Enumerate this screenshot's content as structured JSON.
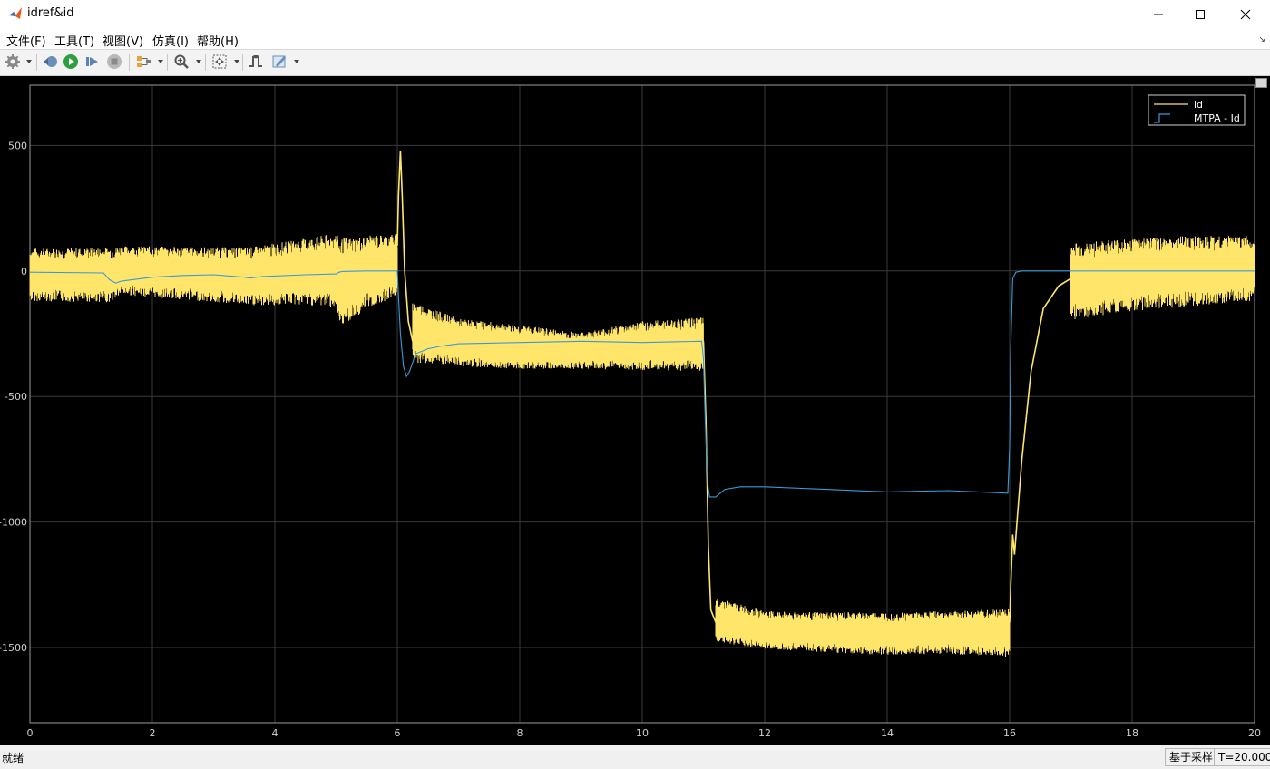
{
  "window": {
    "title": "idref&id"
  },
  "menu": {
    "items": [
      {
        "label": "文件(F)"
      },
      {
        "label": "工具(T)"
      },
      {
        "label": "视图(V)"
      },
      {
        "label": "仿真(I)"
      },
      {
        "label": "帮助(H)"
      }
    ]
  },
  "toolbar": {
    "icons": [
      "gear-icon",
      "step-back-icon",
      "run-icon",
      "step-forward-icon",
      "stop-icon",
      "signal-select-icon",
      "zoom-icon",
      "fit-view-icon",
      "trigger-icon",
      "style-icon"
    ]
  },
  "status": {
    "message": "就绪",
    "sample_mode": "基于采样",
    "time": "T=20.000"
  },
  "colors": {
    "background": "#000000",
    "grid": "#3a3a3a",
    "id_line": "#ffe66a",
    "mtpa_line": "#3a9ad9"
  },
  "chart_data": {
    "type": "line",
    "title": "",
    "xlabel": "",
    "ylabel": "",
    "xlim": [
      0,
      20
    ],
    "ylim": [
      -1800,
      740
    ],
    "x_ticks": [
      0,
      2,
      4,
      6,
      8,
      10,
      12,
      14,
      16,
      18,
      20
    ],
    "y_ticks": [
      -1500,
      -1000,
      -500,
      0,
      500
    ],
    "grid": true,
    "legend": {
      "placement": "top-right"
    },
    "series": [
      {
        "name": "id",
        "color": "#ffe66a",
        "style": "noisy-band",
        "x": [
          0,
          1.3,
          1.5,
          3.0,
          3.6,
          4.5,
          5.0,
          5.05,
          5.5,
          6.0
        ],
        "lo": [
          -120,
          -125,
          -95,
          -125,
          -140,
          -135,
          -145,
          -240,
          -150,
          -100
        ],
        "hi": [
          90,
          95,
          100,
          95,
          95,
          130,
          150,
          130,
          140,
          150
        ]
      },
      {
        "name": "id",
        "color": "#ffe66a",
        "style": "noisy-band",
        "x": [
          6.25,
          7.0,
          8.0,
          9.0,
          10.0,
          11.0
        ],
        "lo": [
          -365,
          -380,
          -390,
          -390,
          -395,
          -400
        ],
        "hi": [
          -120,
          -190,
          -215,
          -245,
          -200,
          -185
        ]
      },
      {
        "name": "id",
        "color": "#ffe66a",
        "style": "noisy-band",
        "x": [
          11.2,
          12.0,
          13.0,
          14.0,
          15.0,
          16.0
        ],
        "lo": [
          -1480,
          -1505,
          -1520,
          -1530,
          -1525,
          -1540
        ],
        "hi": [
          -1300,
          -1355,
          -1360,
          -1360,
          -1355,
          -1345
        ]
      },
      {
        "name": "id",
        "color": "#ffe66a",
        "style": "noisy-band",
        "x": [
          17.0,
          18.0,
          19.0,
          19.95,
          20.0
        ],
        "lo": [
          -195,
          -160,
          -140,
          -120,
          -80
        ],
        "hi": [
          110,
          130,
          140,
          140,
          110
        ]
      },
      {
        "name": "id",
        "color": "#ffe66a",
        "style": "line",
        "x": [
          6.0,
          6.02,
          6.05,
          6.08,
          6.12,
          6.18,
          6.25
        ],
        "y": [
          100,
          300,
          480,
          300,
          0,
          -200,
          -280
        ]
      },
      {
        "name": "id",
        "color": "#ffe66a",
        "style": "line",
        "x": [
          11.0,
          11.04,
          11.08,
          11.12,
          11.2
        ],
        "y": [
          -280,
          -600,
          -1100,
          -1350,
          -1400
        ]
      },
      {
        "name": "id",
        "color": "#ffe66a",
        "style": "line",
        "x": [
          16.0,
          16.02,
          16.05,
          16.08,
          16.12,
          16.2,
          16.35,
          16.55,
          16.8,
          17.0
        ],
        "y": [
          -1400,
          -1250,
          -1050,
          -1130,
          -1000,
          -750,
          -400,
          -150,
          -60,
          -30
        ]
      },
      {
        "name": "MTPA - Id",
        "color": "#3a9ad9",
        "style": "line",
        "x": [
          0,
          1.2,
          1.3,
          1.4,
          1.5,
          2.0,
          2.5,
          3.0,
          3.5,
          3.6,
          3.8,
          4.5,
          5.0,
          5.05,
          5.1,
          5.5,
          6.0,
          6.02,
          6.05,
          6.1,
          6.15,
          6.2,
          6.3,
          6.5,
          6.7,
          7.0,
          8.0,
          9.0,
          10.0,
          10.5,
          10.97,
          11.0,
          11.03,
          11.07,
          11.1,
          11.2,
          11.35,
          11.6,
          12.0,
          13.0,
          14.0,
          15.0,
          15.97,
          16.0,
          16.02,
          16.05,
          16.1,
          16.2,
          20.0
        ],
        "y": [
          -5,
          -8,
          -35,
          -48,
          -40,
          -25,
          -18,
          -15,
          -25,
          -28,
          -22,
          -15,
          -12,
          -5,
          -2,
          0,
          0,
          -100,
          -250,
          -380,
          -420,
          -400,
          -330,
          -310,
          -300,
          -290,
          -285,
          -280,
          -285,
          -282,
          -280,
          -350,
          -600,
          -850,
          -900,
          -900,
          -870,
          -860,
          -860,
          -870,
          -880,
          -875,
          -885,
          -700,
          -300,
          -30,
          -5,
          0,
          0
        ]
      }
    ]
  }
}
